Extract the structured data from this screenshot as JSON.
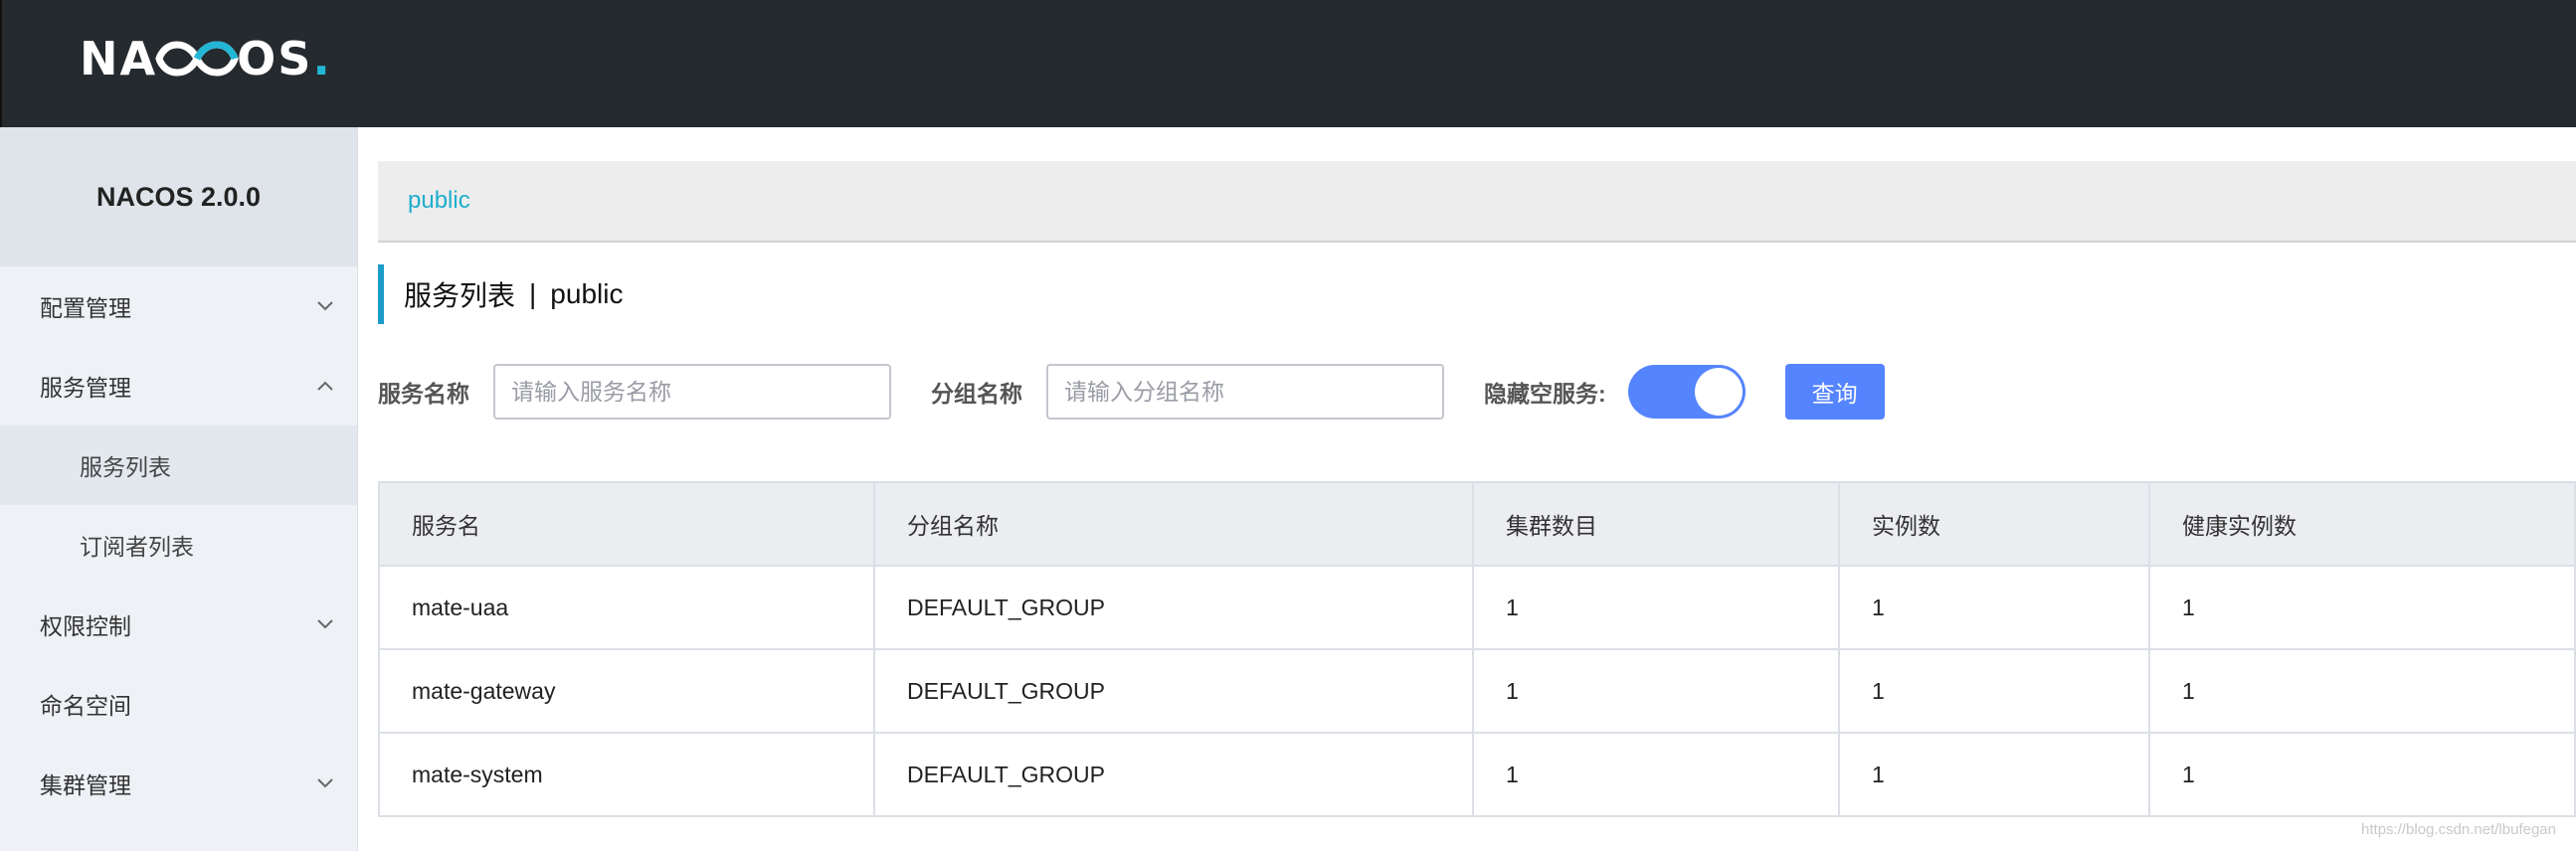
{
  "header": {
    "logo_text_before": "NA",
    "logo_text_after": "OS",
    "logo_dot": ".",
    "logo_accent_color": "#23b7d5"
  },
  "sidebar": {
    "version": "NACOS 2.0.0",
    "items": [
      {
        "label": "配置管理",
        "icon": "chevron-down-icon"
      },
      {
        "label": "服务管理",
        "icon": "chevron-up-icon",
        "expanded": true,
        "children": [
          {
            "label": "服务列表",
            "active": true
          },
          {
            "label": "订阅者列表"
          }
        ]
      },
      {
        "label": "权限控制",
        "icon": "chevron-down-icon"
      },
      {
        "label": "命名空间"
      },
      {
        "label": "集群管理",
        "icon": "chevron-down-icon"
      }
    ]
  },
  "breadcrumb": {
    "namespace": "public"
  },
  "page_title": {
    "title": "服务列表",
    "separator": "|",
    "namespace": "public"
  },
  "filters": {
    "service_name_label": "服务名称",
    "service_name_placeholder": "请输入服务名称",
    "group_name_label": "分组名称",
    "group_name_placeholder": "请输入分组名称",
    "hide_empty_label": "隐藏空服务:",
    "hide_empty_on": true,
    "query_label": "查询"
  },
  "table": {
    "headers": [
      "服务名",
      "分组名称",
      "集群数目",
      "实例数",
      "健康实例数"
    ],
    "rows": [
      [
        "mate-uaa",
        "DEFAULT_GROUP",
        "1",
        "1",
        "1"
      ],
      [
        "mate-gateway",
        "DEFAULT_GROUP",
        "1",
        "1",
        "1"
      ],
      [
        "mate-system",
        "DEFAULT_GROUP",
        "1",
        "1",
        "1"
      ]
    ]
  },
  "watermark": "https://blog.csdn.net/lbufegan"
}
